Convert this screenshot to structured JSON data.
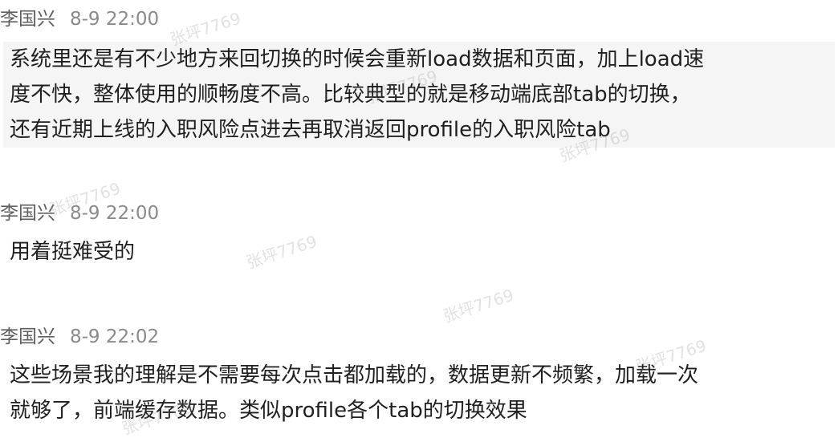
{
  "messages": [
    {
      "sender": "李国兴",
      "time": "8-9 22:00",
      "lines": [
        "系统里还是有不少地方来回切换的时候会重新load数据和页面，加上load速",
        "度不快，整体使用的顺畅度不高。比较典型的就是移动端底部tab的切换，",
        "还有近期上线的入职风险点进去再取消返回profile的入职风险tab"
      ]
    },
    {
      "sender": "李国兴",
      "time": "8-9 22:00",
      "lines": [
        "用着挺难受的"
      ]
    },
    {
      "sender": "李国兴",
      "time": "8-9 22:02",
      "lines": [
        "这些场景我的理解是不需要每次点击都加载的，数据更新不频繁，加载一次",
        "就够了，前端缓存数据。类似profile各个tab的切换效果"
      ]
    }
  ],
  "watermark_text": "张坪7769"
}
